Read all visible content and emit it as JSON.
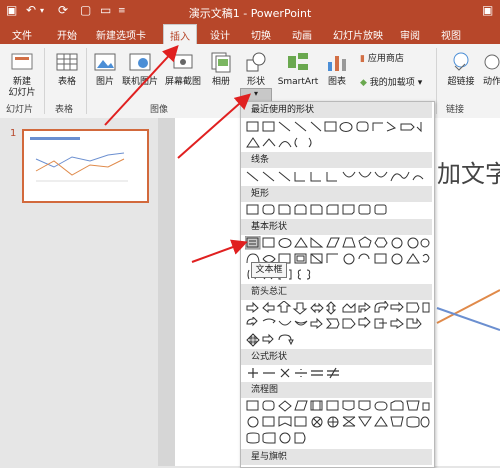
{
  "window": {
    "title": "演示文稿1 - PowerPoint"
  },
  "tabs": [
    {
      "label": "文件"
    },
    {
      "label": "开始"
    },
    {
      "label": "新建选项卡"
    },
    {
      "label": "插入"
    },
    {
      "label": "设计"
    },
    {
      "label": "切换"
    },
    {
      "label": "动画"
    },
    {
      "label": "幻灯片放映"
    },
    {
      "label": "审阅"
    },
    {
      "label": "视图"
    }
  ],
  "ribbon": {
    "new_slide": "新建\n幻灯片",
    "table": "表格",
    "picture": "图片",
    "online_picture": "联机图片",
    "screenshot": "屏幕截图",
    "album": "相册",
    "shapes": "形状",
    "smartart": "SmartArt",
    "chart": "图表",
    "app_store": "应用商店",
    "my_addins": "我的加载项",
    "hyperlink": "超链接",
    "action": "动作",
    "groups": {
      "slides": "幻灯片",
      "tables": "表格",
      "images": "图像",
      "links": "链接"
    }
  },
  "thumbnail": {
    "number": "1"
  },
  "slide": {
    "partial_text": "加文字"
  },
  "shapes_menu": {
    "sections": [
      {
        "title": "最近使用的形状"
      },
      {
        "title": "线条"
      },
      {
        "title": "矩形"
      },
      {
        "title": "基本形状"
      },
      {
        "title": "箭头总汇"
      },
      {
        "title": "公式形状"
      },
      {
        "title": "流程图"
      },
      {
        "title": "星与旗帜"
      }
    ],
    "tooltip": "文本框"
  },
  "colors": {
    "accent": "#b7472a",
    "annotation_arrow": "#e02020",
    "highlight": "#c8c8c8"
  }
}
